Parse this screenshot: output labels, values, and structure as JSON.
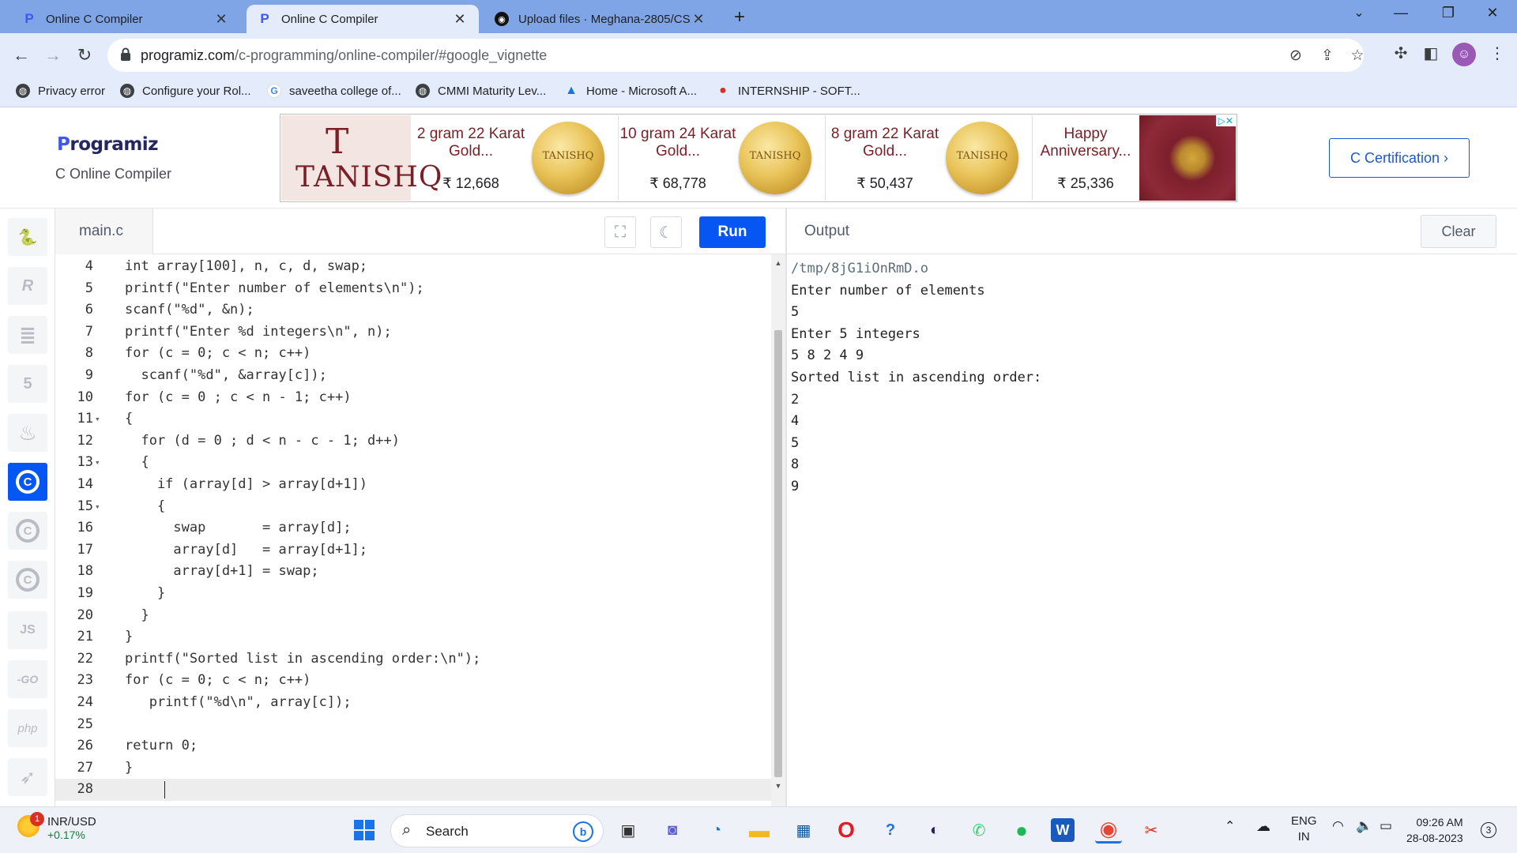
{
  "browser": {
    "tabs": [
      {
        "title": "Online C Compiler",
        "icon": "programiz-icon",
        "active": false
      },
      {
        "title": "Online C Compiler",
        "icon": "programiz-icon",
        "active": true
      },
      {
        "title": "Upload files · Meghana-2805/CS/",
        "icon": "github-icon",
        "active": false
      }
    ],
    "new_tab": "+",
    "url_host": "programiz.com",
    "url_path": "/c-programming/online-compiler/#google_vignette",
    "bookmarks": [
      {
        "label": "Privacy error",
        "icon": "globe-icon"
      },
      {
        "label": "Configure your Rol...",
        "icon": "globe-icon"
      },
      {
        "label": "saveetha college of...",
        "icon": "google-icon"
      },
      {
        "label": "CMMI Maturity Lev...",
        "icon": "globe-icon"
      },
      {
        "label": "Home - Microsoft A...",
        "icon": "azure-icon"
      },
      {
        "label": "INTERNSHIP - SOFT...",
        "icon": "bookmark-red-icon"
      }
    ]
  },
  "header": {
    "logo_text": "rogramiz",
    "logo_mark": "P",
    "subtitle": "C Online Compiler",
    "certification_label": "C Certification ›"
  },
  "ad": {
    "brand": "TANISHQ",
    "brand_mark": "T",
    "items": [
      {
        "title": "2 gram 22 Karat Gold...",
        "price": "₹ 12,668",
        "coin_text": "TANISHQ"
      },
      {
        "title": "10 gram 24 Karat Gold...",
        "price": "₹ 68,778",
        "coin_text": "TANISHQ"
      },
      {
        "title": "8 gram 22 Karat Gold...",
        "price": "₹ 50,437",
        "coin_text": "TANISHQ"
      },
      {
        "title": "Happy Anniversary...",
        "price": "₹ 25,336",
        "coin_text": ""
      }
    ],
    "adchoices": "▷✕"
  },
  "sidebar": {
    "languages": [
      {
        "name": "python",
        "glyph": "🐍",
        "active": false
      },
      {
        "name": "r",
        "glyph": "R",
        "active": false
      },
      {
        "name": "sql",
        "glyph": "≣",
        "active": false
      },
      {
        "name": "html",
        "glyph": "5",
        "active": false
      },
      {
        "name": "java",
        "glyph": "♨",
        "active": false
      },
      {
        "name": "c",
        "glyph": "C",
        "active": true
      },
      {
        "name": "cpp",
        "glyph": "C",
        "active": false
      },
      {
        "name": "csharp",
        "glyph": "C",
        "active": false
      },
      {
        "name": "javascript",
        "glyph": "JS",
        "active": false
      },
      {
        "name": "go",
        "glyph": "-GO",
        "active": false
      },
      {
        "name": "php",
        "glyph": "php",
        "active": false
      },
      {
        "name": "swift",
        "glyph": "➶",
        "active": false
      }
    ]
  },
  "editor": {
    "filename": "main.c",
    "run_label": "Run",
    "lines": [
      {
        "n": "4",
        "fold": "",
        "code": "int array[100], n, c, d, swap;"
      },
      {
        "n": "5",
        "fold": "",
        "code": "printf(\"Enter number of elements\\n\");"
      },
      {
        "n": "6",
        "fold": "",
        "code": "scanf(\"%d\", &n);"
      },
      {
        "n": "7",
        "fold": "",
        "code": "printf(\"Enter %d integers\\n\", n);"
      },
      {
        "n": "8",
        "fold": "",
        "code": "for (c = 0; c < n; c++)"
      },
      {
        "n": "9",
        "fold": "",
        "code": "  scanf(\"%d\", &array[c]);"
      },
      {
        "n": "10",
        "fold": "",
        "code": "for (c = 0 ; c < n - 1; c++)"
      },
      {
        "n": "11",
        "fold": "▾",
        "code": "{"
      },
      {
        "n": "12",
        "fold": "",
        "code": "  for (d = 0 ; d < n - c - 1; d++)"
      },
      {
        "n": "13",
        "fold": "▾",
        "code": "  {"
      },
      {
        "n": "14",
        "fold": "",
        "code": "    if (array[d] > array[d+1])"
      },
      {
        "n": "15",
        "fold": "▾",
        "code": "    {"
      },
      {
        "n": "16",
        "fold": "",
        "code": "      swap       = array[d];"
      },
      {
        "n": "17",
        "fold": "",
        "code": "      array[d]   = array[d+1];"
      },
      {
        "n": "18",
        "fold": "",
        "code": "      array[d+1] = swap;"
      },
      {
        "n": "19",
        "fold": "",
        "code": "    }"
      },
      {
        "n": "20",
        "fold": "",
        "code": "  }"
      },
      {
        "n": "21",
        "fold": "",
        "code": "}"
      },
      {
        "n": "22",
        "fold": "",
        "code": "printf(\"Sorted list in ascending order:\\n\");"
      },
      {
        "n": "23",
        "fold": "",
        "code": "for (c = 0; c < n; c++)"
      },
      {
        "n": "24",
        "fold": "",
        "code": "   printf(\"%d\\n\", array[c]);"
      },
      {
        "n": "25",
        "fold": "",
        "code": ""
      },
      {
        "n": "26",
        "fold": "",
        "code": "return 0;"
      },
      {
        "n": "27",
        "fold": "",
        "code": "}"
      },
      {
        "n": "28",
        "fold": "",
        "code": ""
      }
    ],
    "current_line": "28"
  },
  "output": {
    "title": "Output",
    "clear_label": "Clear",
    "lines": [
      "/tmp/8jG1iOnRmD.o",
      "Enter number of elements",
      "5",
      "Enter 5 integers",
      "5 8 2 4 9",
      "Sorted list in ascending order:",
      "2",
      "4",
      "5",
      "8",
      "9"
    ]
  },
  "taskbar": {
    "ticker_pair": "INR/USD",
    "ticker_change": "+0.17%",
    "ticker_badge": "1",
    "search_label": "Search",
    "lang_top": "ENG",
    "lang_bottom": "IN",
    "time": "09:26 AM",
    "date": "28-08-2023",
    "notification_count": "3"
  }
}
